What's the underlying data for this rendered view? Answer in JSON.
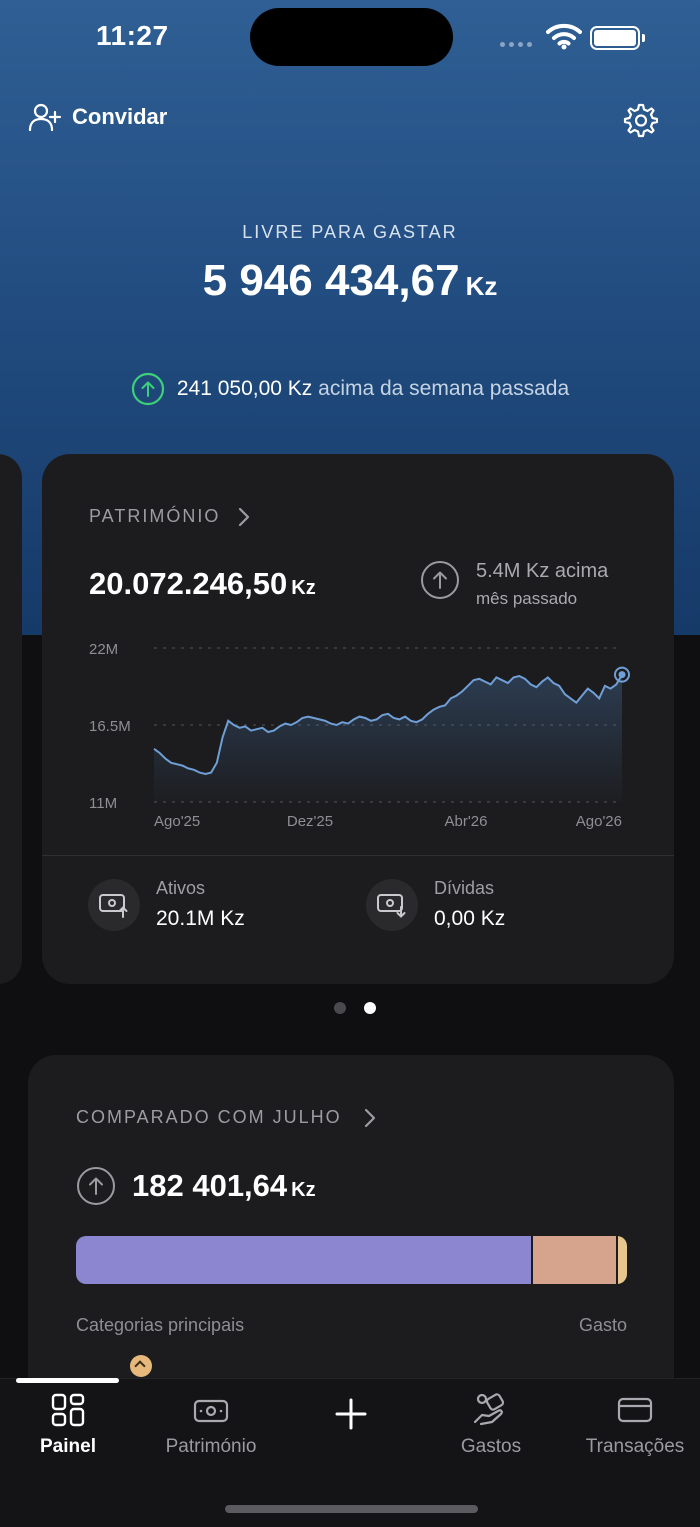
{
  "status_bar": {
    "time": "11:27"
  },
  "top_bar": {
    "invite_label": "Convidar"
  },
  "hero": {
    "label": "LIVRE PARA GASTAR",
    "amount": "5 946 434,67",
    "currency": "Kz",
    "delta_amount": "241 050,00 Kz",
    "delta_text": "acima da semana passada"
  },
  "net_worth_card": {
    "title": "PATRIMÓNIO",
    "value": "20.072.246,50",
    "currency": "Kz",
    "delta_line1": "5.4M Kz acima",
    "delta_line2": "mês passado",
    "assets_label": "Ativos",
    "assets_value": "20.1M Kz",
    "debts_label": "Dívidas",
    "debts_value": "0,00 Kz"
  },
  "chart_data": {
    "type": "area",
    "y_tick_labels": [
      "22M",
      "16.5M",
      "11M"
    ],
    "x_tick_labels": [
      "Ago'25",
      "Dez'25",
      "Abr'26",
      "Ago'26"
    ],
    "ylim": [
      11,
      22
    ],
    "grid": true,
    "line_color": "#6f9fd6",
    "values": [
      14.8,
      14.5,
      14.1,
      13.8,
      13.7,
      13.6,
      13.4,
      13.3,
      13.1,
      13.0,
      13.1,
      13.8,
      15.6,
      16.8,
      16.5,
      16.3,
      16.4,
      16.1,
      16.2,
      16.3,
      16.0,
      16.1,
      16.4,
      16.6,
      16.5,
      16.7,
      17.0,
      17.1,
      17.0,
      16.9,
      16.8,
      16.6,
      16.5,
      16.7,
      16.6,
      16.9,
      17.1,
      17.0,
      16.8,
      16.9,
      17.2,
      17.3,
      17.0,
      16.9,
      17.1,
      16.8,
      16.7,
      16.9,
      17.3,
      17.6,
      17.8,
      17.9,
      18.4,
      18.6,
      18.9,
      19.3,
      19.7,
      19.8,
      19.6,
      19.4,
      19.9,
      19.7,
      19.5,
      19.9,
      20.0,
      19.8,
      19.4,
      19.2,
      19.6,
      19.9,
      19.5,
      19.3,
      18.7,
      18.4,
      18.1,
      18.6,
      19.1,
      18.8,
      18.4,
      19.3,
      19.1,
      19.4,
      20.1
    ]
  },
  "pager": {
    "count": 2,
    "active": 1
  },
  "compare_card": {
    "title": "COMPARADO COM JULHO",
    "value": "182 401,64",
    "currency": "Kz",
    "left_label": "Categorias principais",
    "right_label": "Gasto",
    "segments": [
      {
        "share": 0.825,
        "color": "#8b86cf"
      },
      {
        "share": 0.155,
        "color": "#d6a38d"
      },
      {
        "share": 0.02,
        "color": "#e8c58c"
      }
    ]
  },
  "tabs": [
    {
      "label": "Painel",
      "icon": "dashboard-icon",
      "active": true
    },
    {
      "label": "Património",
      "icon": "money-icon",
      "active": false
    },
    {
      "label": "",
      "icon": "plus-icon",
      "active": false
    },
    {
      "label": "Gastos",
      "icon": "spending-icon",
      "active": false
    },
    {
      "label": "Transações",
      "icon": "card-icon",
      "active": false
    }
  ],
  "colors": {
    "accent_green": "#3ecf7a",
    "card_bg": "#1c1c1e",
    "hero_blue": "#255186"
  }
}
